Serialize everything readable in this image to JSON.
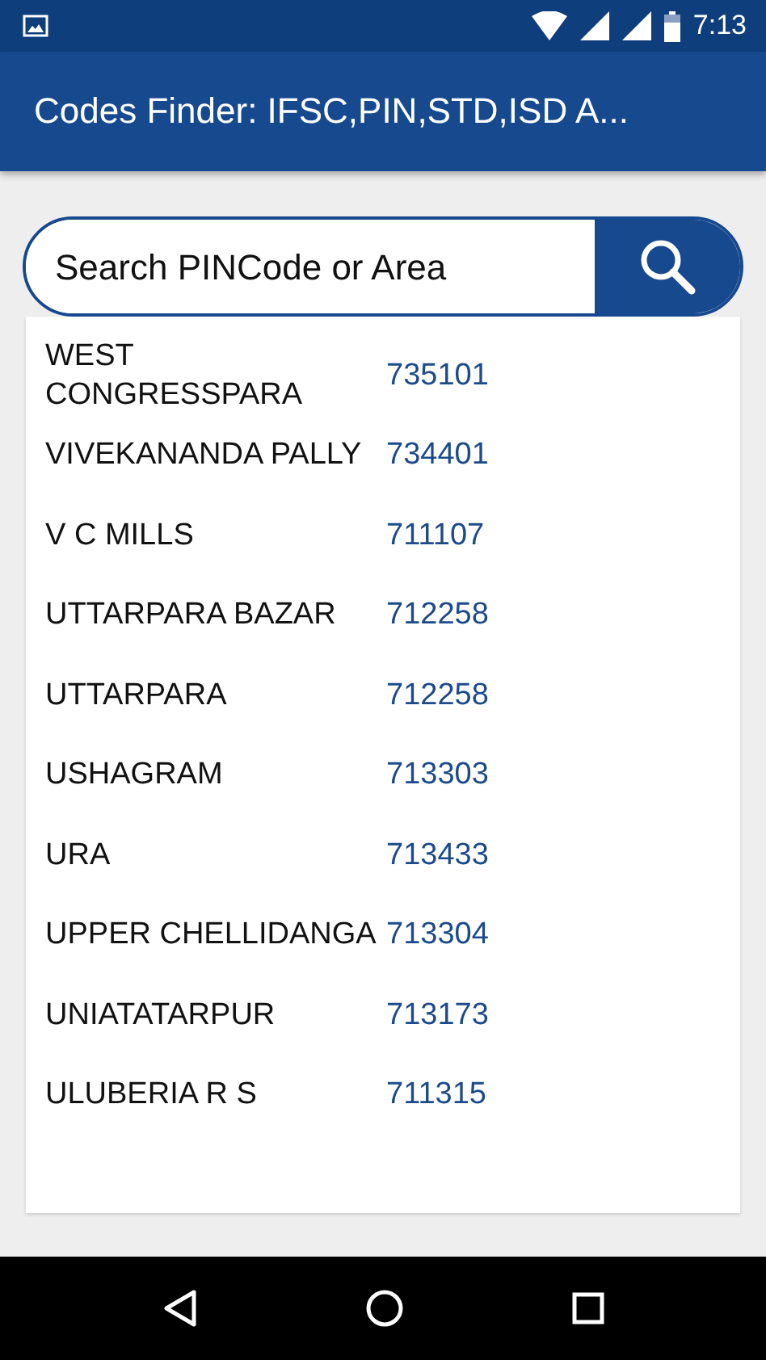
{
  "status_bar": {
    "time": "7:13"
  },
  "app_bar": {
    "title": "Codes Finder: IFSC,PIN,STD,ISD A..."
  },
  "search": {
    "placeholder": "Search PINCode or Area"
  },
  "results": [
    {
      "area": "WEST CONGRESSPARA",
      "pin": "735101"
    },
    {
      "area": "VIVEKANANDA PALLY",
      "pin": "734401"
    },
    {
      "area": "V C MILLS",
      "pin": "711107"
    },
    {
      "area": "UTTARPARA BAZAR",
      "pin": "712258"
    },
    {
      "area": "UTTARPARA",
      "pin": "712258"
    },
    {
      "area": "USHAGRAM",
      "pin": "713303"
    },
    {
      "area": "URA",
      "pin": "713433"
    },
    {
      "area": "UPPER CHELLIDANGA",
      "pin": "713304"
    },
    {
      "area": "UNIATATARPUR",
      "pin": "713173"
    },
    {
      "area": "ULUBERIA R S",
      "pin": "711315"
    }
  ]
}
